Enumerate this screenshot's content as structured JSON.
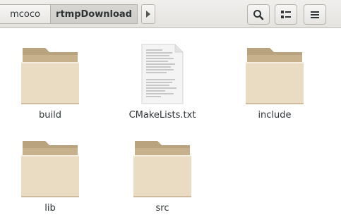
{
  "pathbar": {
    "home_label": "mcoco",
    "current_label": "rtmpDownload",
    "next_icon": "chevron-right-icon"
  },
  "toolbar": {
    "search_icon": "search-icon",
    "view_toggle_icon": "list-view-icon",
    "menu_icon": "hamburger-menu-icon"
  },
  "files": [
    {
      "name": "build",
      "type": "folder"
    },
    {
      "name": "CMakeLists.txt",
      "type": "text-file"
    },
    {
      "name": "include",
      "type": "folder"
    },
    {
      "name": "lib",
      "type": "folder"
    },
    {
      "name": "src",
      "type": "folder"
    }
  ],
  "colors": {
    "folder_front": "#e9dcc2",
    "folder_back": "#c9b38f",
    "header_bg": "#e8e7e4"
  }
}
